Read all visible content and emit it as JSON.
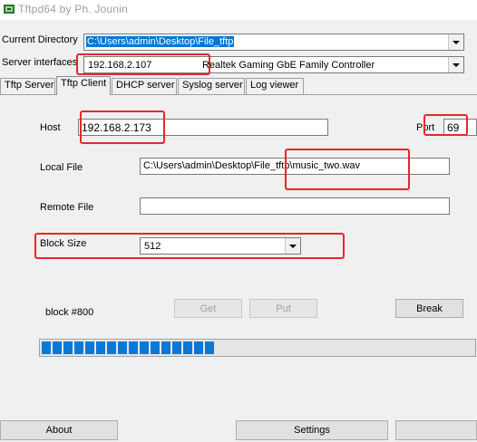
{
  "window": {
    "title": "Tftpd64 by Ph. Jounin",
    "icon": "tftpd-app-icon"
  },
  "current_directory": {
    "label": "Current Directory",
    "value": "C:\\Users\\admin\\Desktop\\File_tftp"
  },
  "server_interfaces": {
    "label": "Server interfaces",
    "ip": "192.168.2.107",
    "adapter": "Realtek Gaming GbE Family Controller"
  },
  "tabs": [
    {
      "label": "Tftp Server"
    },
    {
      "label": "Tftp Client",
      "active": true
    },
    {
      "label": "DHCP server"
    },
    {
      "label": "Syslog server"
    },
    {
      "label": "Log viewer"
    }
  ],
  "client": {
    "host_label": "Host",
    "host_value": "192.168.2.173",
    "port_label": "Port",
    "port_value": "69",
    "local_file_label": "Local File",
    "local_file_value": "C:\\Users\\admin\\Desktop\\File_tftp\\music_two.wav",
    "remote_file_label": "Remote File",
    "remote_file_value": "",
    "block_size_label": "Block Size",
    "block_size_value": "512",
    "status": "block #800",
    "get_label": "Get",
    "put_label": "Put",
    "break_label": "Break",
    "progress_percent": 40
  },
  "footer": {
    "about_label": "About",
    "settings_label": "Settings"
  },
  "colors": {
    "highlight": "#e8262a",
    "progress": "#0a78d7",
    "selection": "#0078d7"
  }
}
